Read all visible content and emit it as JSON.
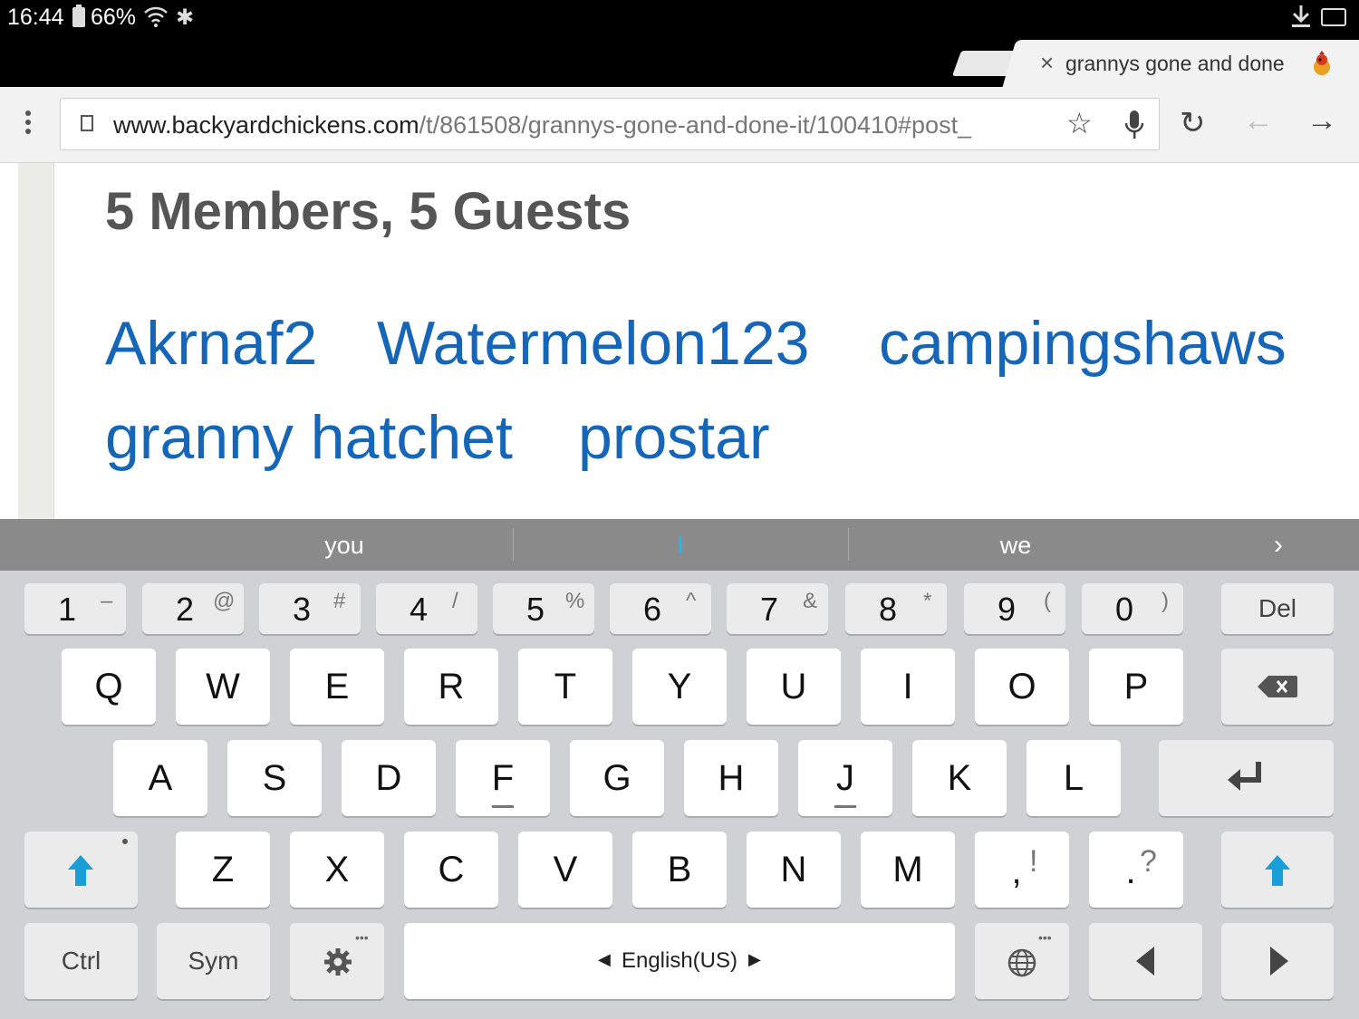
{
  "status_bar": {
    "time": "16:44",
    "battery": "66%"
  },
  "tab": {
    "close": "×",
    "title": "grannys gone and done"
  },
  "toolbar": {
    "url_main": "www.backyardchickens.com",
    "url_rest": "/t/861508/grannys-gone-and-done-it/100410#post_",
    "star": "☆",
    "reload": "↻",
    "back": "←",
    "forward": "→"
  },
  "content": {
    "heading": "5 Members, 5 Guests",
    "members": [
      "Akrnaf2",
      "Watermelon123",
      "campingshaws",
      "granny hatchet",
      "prostar"
    ]
  },
  "suggestions": {
    "left": "you",
    "center": "I",
    "right": "we",
    "more": "›"
  },
  "keyboard": {
    "numbers": [
      {
        "k": "1",
        "s": "–"
      },
      {
        "k": "2",
        "s": "@"
      },
      {
        "k": "3",
        "s": "#"
      },
      {
        "k": "4",
        "s": "/"
      },
      {
        "k": "5",
        "s": "%"
      },
      {
        "k": "6",
        "s": "^"
      },
      {
        "k": "7",
        "s": "&"
      },
      {
        "k": "8",
        "s": "*"
      },
      {
        "k": "9",
        "s": "("
      },
      {
        "k": "0",
        "s": ")"
      }
    ],
    "del": "Del",
    "row1": [
      "Q",
      "W",
      "E",
      "R",
      "T",
      "Y",
      "U",
      "I",
      "O",
      "P"
    ],
    "row2": [
      "A",
      "S",
      "D",
      "F",
      "G",
      "H",
      "J",
      "K",
      "L"
    ],
    "row3": [
      "Z",
      "X",
      "C",
      "V",
      "B",
      "N",
      "M"
    ],
    "comma": {
      "k": ",",
      "s": "!"
    },
    "period": {
      "k": ".",
      "s": "?"
    },
    "ctrl": "Ctrl",
    "sym": "Sym",
    "space_lang": "English(US)"
  }
}
